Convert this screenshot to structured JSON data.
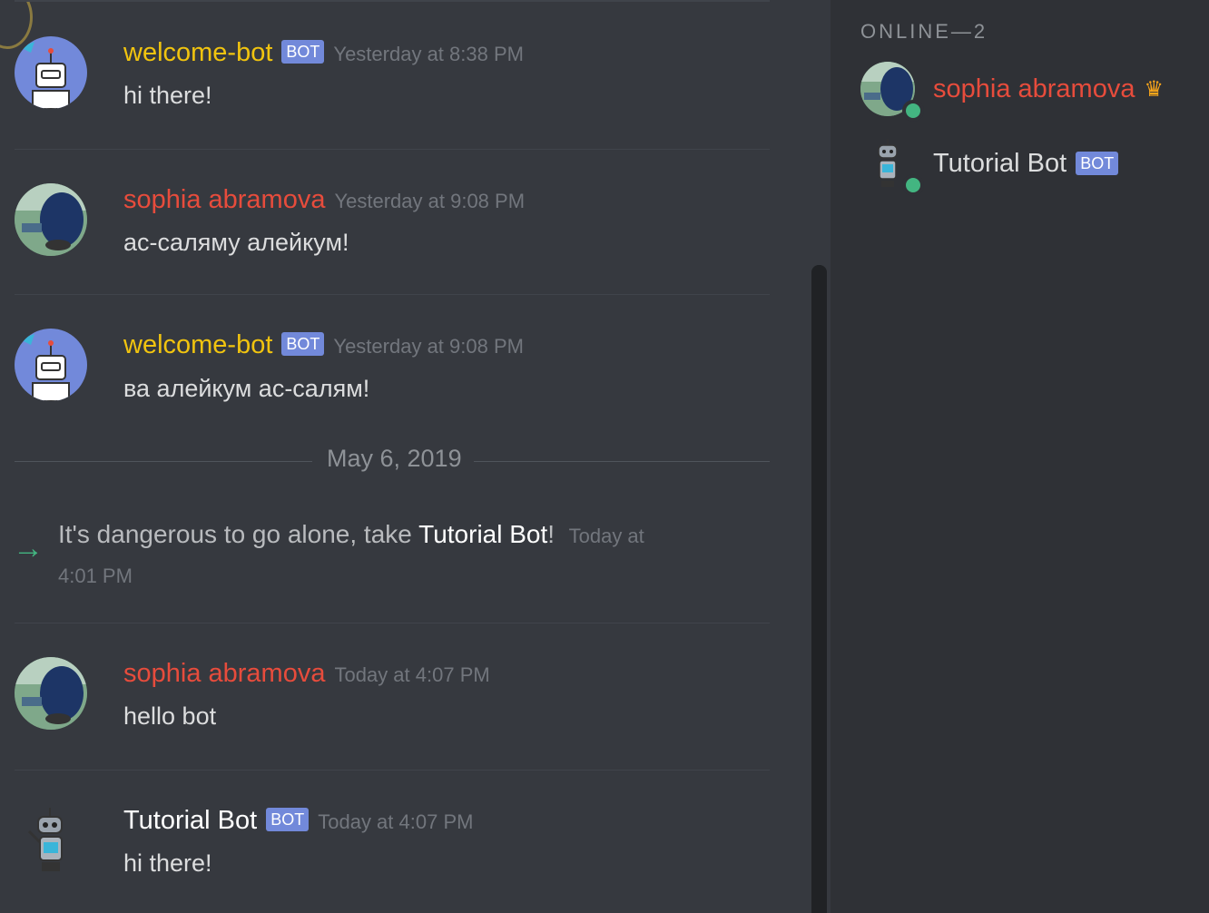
{
  "messages": [
    {
      "author": "welcome-bot",
      "badge": "BOT",
      "timestamp": "Yesterday at 8:38 PM",
      "text": "hi there!",
      "color": "#f1c40f",
      "avatar": "robot-avatar"
    },
    {
      "author": "sophia abramova",
      "timestamp": "Yesterday at 9:08 PM",
      "text": "ас-саляму алейкум!",
      "color": "#e74c3c",
      "avatar": "user-photo-avatar"
    },
    {
      "author": "welcome-bot",
      "badge": "BOT",
      "timestamp": "Yesterday at 9:08 PM",
      "text": "ва алейкум ас-салям!",
      "color": "#f1c40f",
      "avatar": "robot-avatar"
    },
    {
      "author": "sophia abramova",
      "timestamp": "Today at 4:07 PM",
      "text": "hello bot",
      "color": "#e74c3c",
      "avatar": "user-photo-avatar"
    },
    {
      "author": "Tutorial Bot",
      "badge": "BOT",
      "timestamp": "Today at 4:07 PM",
      "text": "hi there!",
      "color": "#ffffff",
      "avatar": "tutorial-bot-avatar"
    }
  ],
  "date_separator": "May 6, 2019",
  "system_message": {
    "prefix": "It's dangerous to go alone, take ",
    "highlight": "Tutorial Bot",
    "suffix": "!",
    "timestamp_line1": "Today at",
    "timestamp_line2": "4:01 PM",
    "icon": "join-arrow-icon"
  },
  "members": {
    "heading": "ONLINE—2",
    "list": [
      {
        "name": "sophia abramova",
        "owner_icon": "crown-icon",
        "status": "online"
      },
      {
        "name": "Tutorial Bot",
        "badge": "BOT",
        "status": "online"
      }
    ]
  },
  "colors": {
    "background": "#36393f",
    "sidebar": "#2f3136",
    "blurple": "#7289da",
    "online": "#43b581"
  }
}
